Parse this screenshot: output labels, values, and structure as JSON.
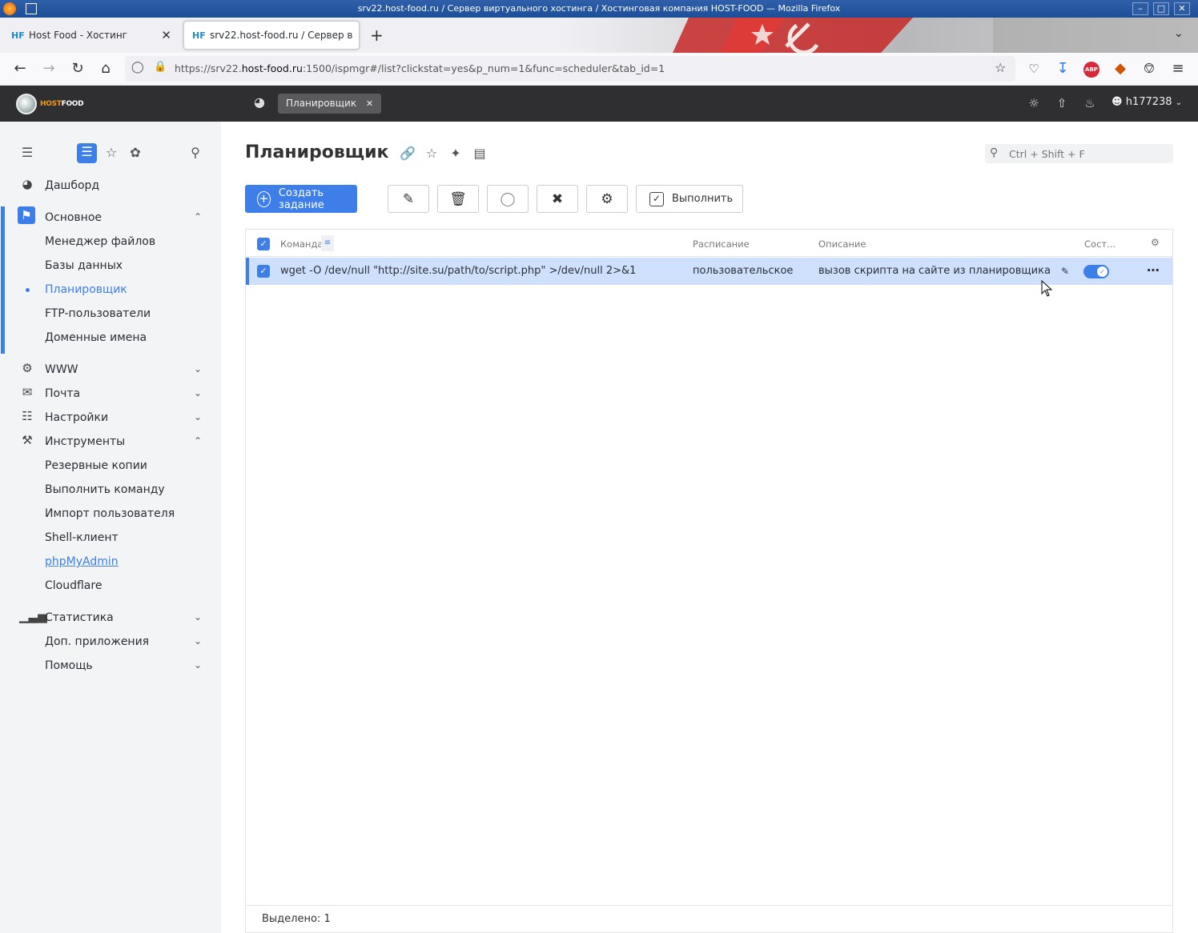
{
  "window": {
    "title": "srv22.host-food.ru / Сервер виртуального хостинга / Хостинговая компания HOST-FOOD — Mozilla Firefox"
  },
  "browser": {
    "tabs": [
      {
        "label": "Host Food - Хостинг",
        "favicon": "HF"
      },
      {
        "label": "srv22.host-food.ru / Сервер в",
        "favicon": "HF"
      }
    ],
    "url_host_prefix": "https://srv22.",
    "url_host_main": "host-food.ru",
    "url_rest": ":1500/ispmgr#/list?clickstat=yes&p_num=1&func=scheduler&tab_id=1",
    "ext_abp": "ABP"
  },
  "app": {
    "logo_text_a": "HOST",
    "logo_text_b": "FOOD",
    "open_tab": "Планировщик",
    "username": "h177238"
  },
  "sidebar": {
    "items": [
      {
        "label": "Дашборд"
      },
      {
        "label": "Основное"
      },
      {
        "label": "Менеджер файлов"
      },
      {
        "label": "Базы данных"
      },
      {
        "label": "Планировщик"
      },
      {
        "label": "FTP-пользователи"
      },
      {
        "label": "Доменные имена"
      },
      {
        "label": "WWW"
      },
      {
        "label": "Почта"
      },
      {
        "label": "Настройки"
      },
      {
        "label": "Инструменты"
      },
      {
        "label": "Резервные копии"
      },
      {
        "label": "Выполнить команду"
      },
      {
        "label": "Импорт пользователя"
      },
      {
        "label": "Shell-клиент"
      },
      {
        "label": "phpMyAdmin"
      },
      {
        "label": "Cloudflare"
      },
      {
        "label": "Статистика"
      },
      {
        "label": "Доп. приложения"
      },
      {
        "label": "Помощь"
      }
    ]
  },
  "page": {
    "title": "Планировщик",
    "search_placeholder": "Ctrl + Shift + F",
    "create_label": "Создать задание",
    "run_label": "Выполнить"
  },
  "table": {
    "columns": [
      "Команда",
      "Расписание",
      "Описание",
      "Сост..."
    ],
    "rows": [
      {
        "command": "wget -O /dev/null \"http://site.su/path/to/script.php\" >/dev/null 2>&1",
        "schedule": "пользовательское",
        "description": "вызов скрипта на сайте из планировщика",
        "enabled": true
      }
    ],
    "footer": "Выделено: 1"
  },
  "colors": {
    "accent": "#3d7ee8",
    "header_bg": "#2f2f31",
    "selected_row": "#cfe0fd"
  }
}
